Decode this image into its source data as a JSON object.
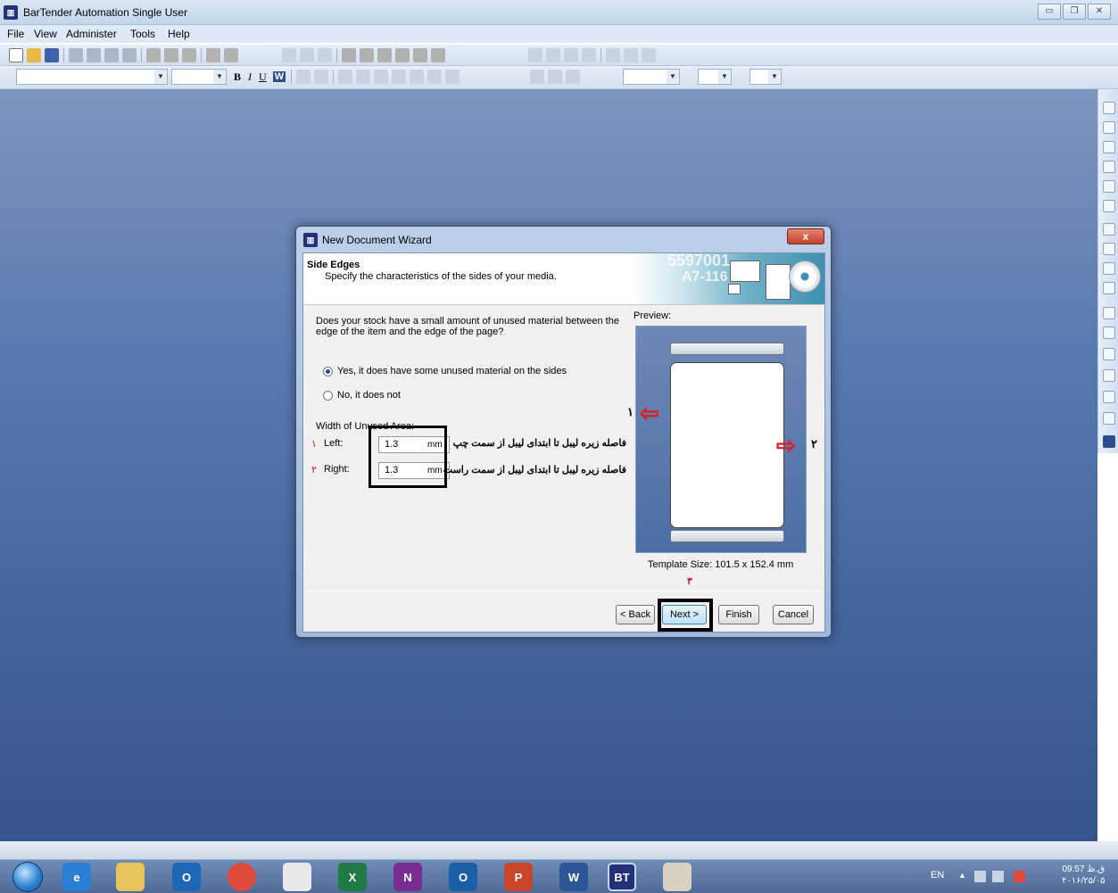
{
  "app": {
    "title": "BarTender Automation Single User"
  },
  "menu": [
    "File",
    "View",
    "Administer",
    "Tools",
    "Help"
  ],
  "toolbar": {
    "bold": "B",
    "italic": "I",
    "underline": "U",
    "word": "W"
  },
  "dialog": {
    "title": "New Document Wizard",
    "close": "x",
    "header_title": "Side Edges",
    "header_subtitle": "Specify the characteristics of the sides of your media.",
    "header_art_text1": "5597001",
    "header_art_text2": "A7-116",
    "question": "Does your stock have a small amount of unused material between the edge of the item and the edge of the page?",
    "options": [
      {
        "label": "Yes, it does have some unused material on the sides",
        "selected": true
      },
      {
        "label": "No, it does not",
        "selected": false
      }
    ],
    "width_label": "Width of Unused Area:",
    "left": {
      "num": "۱",
      "label": "Left:",
      "value": "1.3",
      "unit": "mm",
      "note": "فاصله زیره لیبل تا ابتدای لیبل از سمت چپ"
    },
    "right": {
      "num": "۲",
      "label": "Right:",
      "value": "1.3",
      "unit": "mm",
      "note": "فاصله زیره لیبل تا ابتدای لیبل از سمت راست"
    },
    "preview_label": "Preview:",
    "preview_marker1": "۱",
    "preview_marker2": "۲",
    "template_size": "Template Size:  101.5 x 152.4 mm",
    "step_marker": "۳",
    "buttons": {
      "back": "< Back",
      "next": "Next >",
      "finish": "Finish",
      "cancel": "Cancel"
    }
  },
  "taskbar": {
    "apps": [
      {
        "name": "internet-explorer",
        "label": "e",
        "color": "#2a7fd4"
      },
      {
        "name": "file-explorer",
        "label": "",
        "color": "#e8c35a"
      },
      {
        "name": "outlook-app",
        "label": "O",
        "color": "#1c68b6"
      },
      {
        "name": "chrome",
        "label": "",
        "color": "#e04a3a"
      },
      {
        "name": "paint-app",
        "label": "",
        "color": "#e8e8e8"
      },
      {
        "name": "excel",
        "label": "X",
        "color": "#1f7a44"
      },
      {
        "name": "onenote",
        "label": "N",
        "color": "#7a2d91"
      },
      {
        "name": "outlook",
        "label": "O",
        "color": "#1a5fa8"
      },
      {
        "name": "powerpoint",
        "label": "P",
        "color": "#c9452a"
      },
      {
        "name": "word",
        "label": "W",
        "color": "#2b5797"
      },
      {
        "name": "bartender",
        "label": "BT",
        "color": "#23317a"
      },
      {
        "name": "paint",
        "label": "",
        "color": "#d9d2c0"
      }
    ],
    "lang": "EN",
    "time": "ق.ظ 09:57",
    "date": "۲۰۱۶/۲۵/۰۵"
  }
}
